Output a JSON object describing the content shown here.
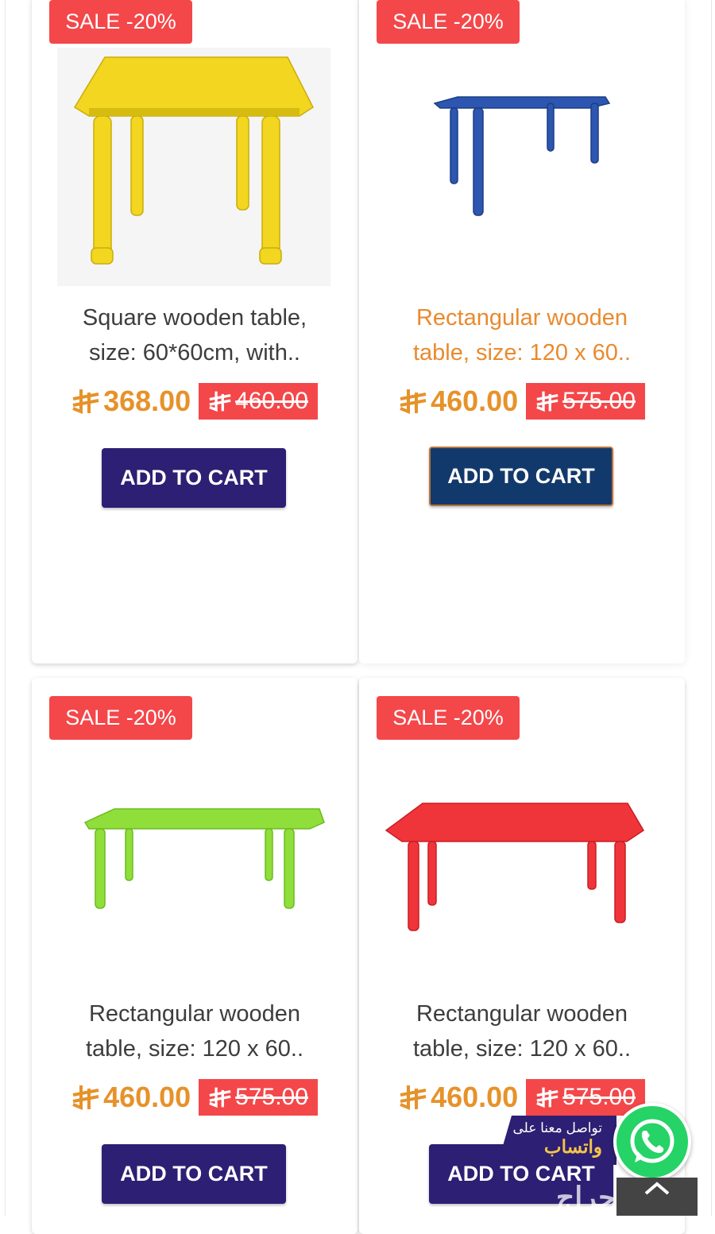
{
  "products": [
    {
      "badge": "SALE -20%",
      "title_line1": "Square wooden table,",
      "title_line2": "size: 60*60cm, with..",
      "price": "368.00",
      "old_price": "460.00",
      "button": "ADD TO CART",
      "color": "#f2d61f"
    },
    {
      "badge": "SALE -20%",
      "title_line1": "Rectangular wooden",
      "title_line2": "table, size: 120 x 60..",
      "price": "460.00",
      "old_price": "575.00",
      "button": "ADD TO CART",
      "color": "#2d56b0"
    },
    {
      "badge": "SALE -20%",
      "title_line1": "Rectangular wooden",
      "title_line2": "table, size: 120 x 60..",
      "price": "460.00",
      "old_price": "575.00",
      "button": "ADD TO CART",
      "color": "#8fde3a"
    },
    {
      "badge": "SALE -20%",
      "title_line1": "Rectangular wooden",
      "title_line2": "table, size: 120 x 60..",
      "price": "460.00",
      "old_price": "575.00",
      "button": "ADD TO CART",
      "color": "#f0353a"
    }
  ],
  "whatsapp": {
    "line1": "تواصل معنا على",
    "line2": "واتساب"
  },
  "watermark": "حراج",
  "icons": {
    "currency": "saudi-riyal-icon",
    "whatsapp": "whatsapp-icon",
    "scroll_top": "chevron-up-icon"
  }
}
